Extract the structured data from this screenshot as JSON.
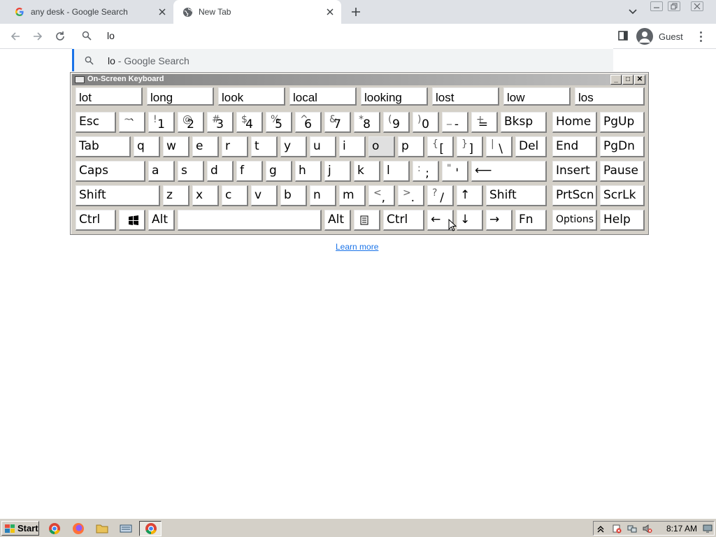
{
  "browser": {
    "tabs": [
      {
        "title": "any desk - Google Search",
        "active": false
      },
      {
        "title": "New Tab",
        "active": true
      }
    ],
    "omnibox": {
      "value": "lo"
    },
    "suggestion": {
      "query": "lo",
      "suffix": " - Google Search"
    },
    "profile": {
      "name": "Guest"
    }
  },
  "page": {
    "learn_more": "Learn more"
  },
  "osk": {
    "title": "On-Screen Keyboard",
    "predictions": [
      "lot",
      "long",
      "look",
      "local",
      "looking",
      "lost",
      "low",
      "los"
    ],
    "row1": [
      {
        "label": "Esc"
      },
      {
        "shift": "~",
        "main": "`"
      },
      {
        "shift": "!",
        "main": "1"
      },
      {
        "shift": "@",
        "main": "2"
      },
      {
        "shift": "#",
        "main": "3"
      },
      {
        "shift": "$",
        "main": "4"
      },
      {
        "shift": "%",
        "main": "5"
      },
      {
        "shift": "^",
        "main": "6"
      },
      {
        "shift": "&",
        "main": "7"
      },
      {
        "shift": "*",
        "main": "8"
      },
      {
        "shift": "(",
        "main": "9"
      },
      {
        "shift": ")",
        "main": "0"
      },
      {
        "shift": "_",
        "main": "-"
      },
      {
        "shift": "+",
        "main": "="
      },
      {
        "label": "Bksp"
      },
      {
        "label": "Home"
      },
      {
        "label": "PgUp"
      }
    ],
    "row2": [
      {
        "label": "Tab"
      },
      {
        "label": "q"
      },
      {
        "label": "w"
      },
      {
        "label": "e"
      },
      {
        "label": "r"
      },
      {
        "label": "t"
      },
      {
        "label": "y"
      },
      {
        "label": "u"
      },
      {
        "label": "i"
      },
      {
        "label": "o"
      },
      {
        "label": "p"
      },
      {
        "shift": "{",
        "main": "["
      },
      {
        "shift": "}",
        "main": "]"
      },
      {
        "shift": "|",
        "main": "\\"
      },
      {
        "label": "Del"
      },
      {
        "label": "End"
      },
      {
        "label": "PgDn"
      }
    ],
    "row3": [
      {
        "label": "Caps"
      },
      {
        "label": "a"
      },
      {
        "label": "s"
      },
      {
        "label": "d"
      },
      {
        "label": "f"
      },
      {
        "label": "g"
      },
      {
        "label": "h"
      },
      {
        "label": "j"
      },
      {
        "label": "k"
      },
      {
        "label": "l"
      },
      {
        "shift": ":",
        "main": ";"
      },
      {
        "shift": "\"",
        "main": "'"
      },
      {
        "label": "⟵"
      },
      {
        "label": "Insert"
      },
      {
        "label": "Pause"
      }
    ],
    "row4": [
      {
        "label": "Shift"
      },
      {
        "label": "z"
      },
      {
        "label": "x"
      },
      {
        "label": "c"
      },
      {
        "label": "v"
      },
      {
        "label": "b"
      },
      {
        "label": "n"
      },
      {
        "label": "m"
      },
      {
        "shift": "<",
        "main": ","
      },
      {
        "shift": ">",
        "main": "."
      },
      {
        "shift": "?",
        "main": "/"
      },
      {
        "label": "↑"
      },
      {
        "label": "Shift"
      },
      {
        "label": "PrtScn"
      },
      {
        "label": "ScrLk"
      }
    ],
    "row5": [
      {
        "label": "Ctrl"
      },
      {
        "label": ""
      },
      {
        "label": "Alt"
      },
      {
        "label": ""
      },
      {
        "label": "Alt"
      },
      {
        "label": ""
      },
      {
        "label": "Ctrl"
      },
      {
        "label": "←"
      },
      {
        "label": "↓"
      },
      {
        "label": "→"
      },
      {
        "label": "Fn"
      },
      {
        "label": "Options"
      },
      {
        "label": "Help"
      }
    ]
  },
  "taskbar": {
    "start": "Start",
    "clock": "8:17 AM"
  }
}
